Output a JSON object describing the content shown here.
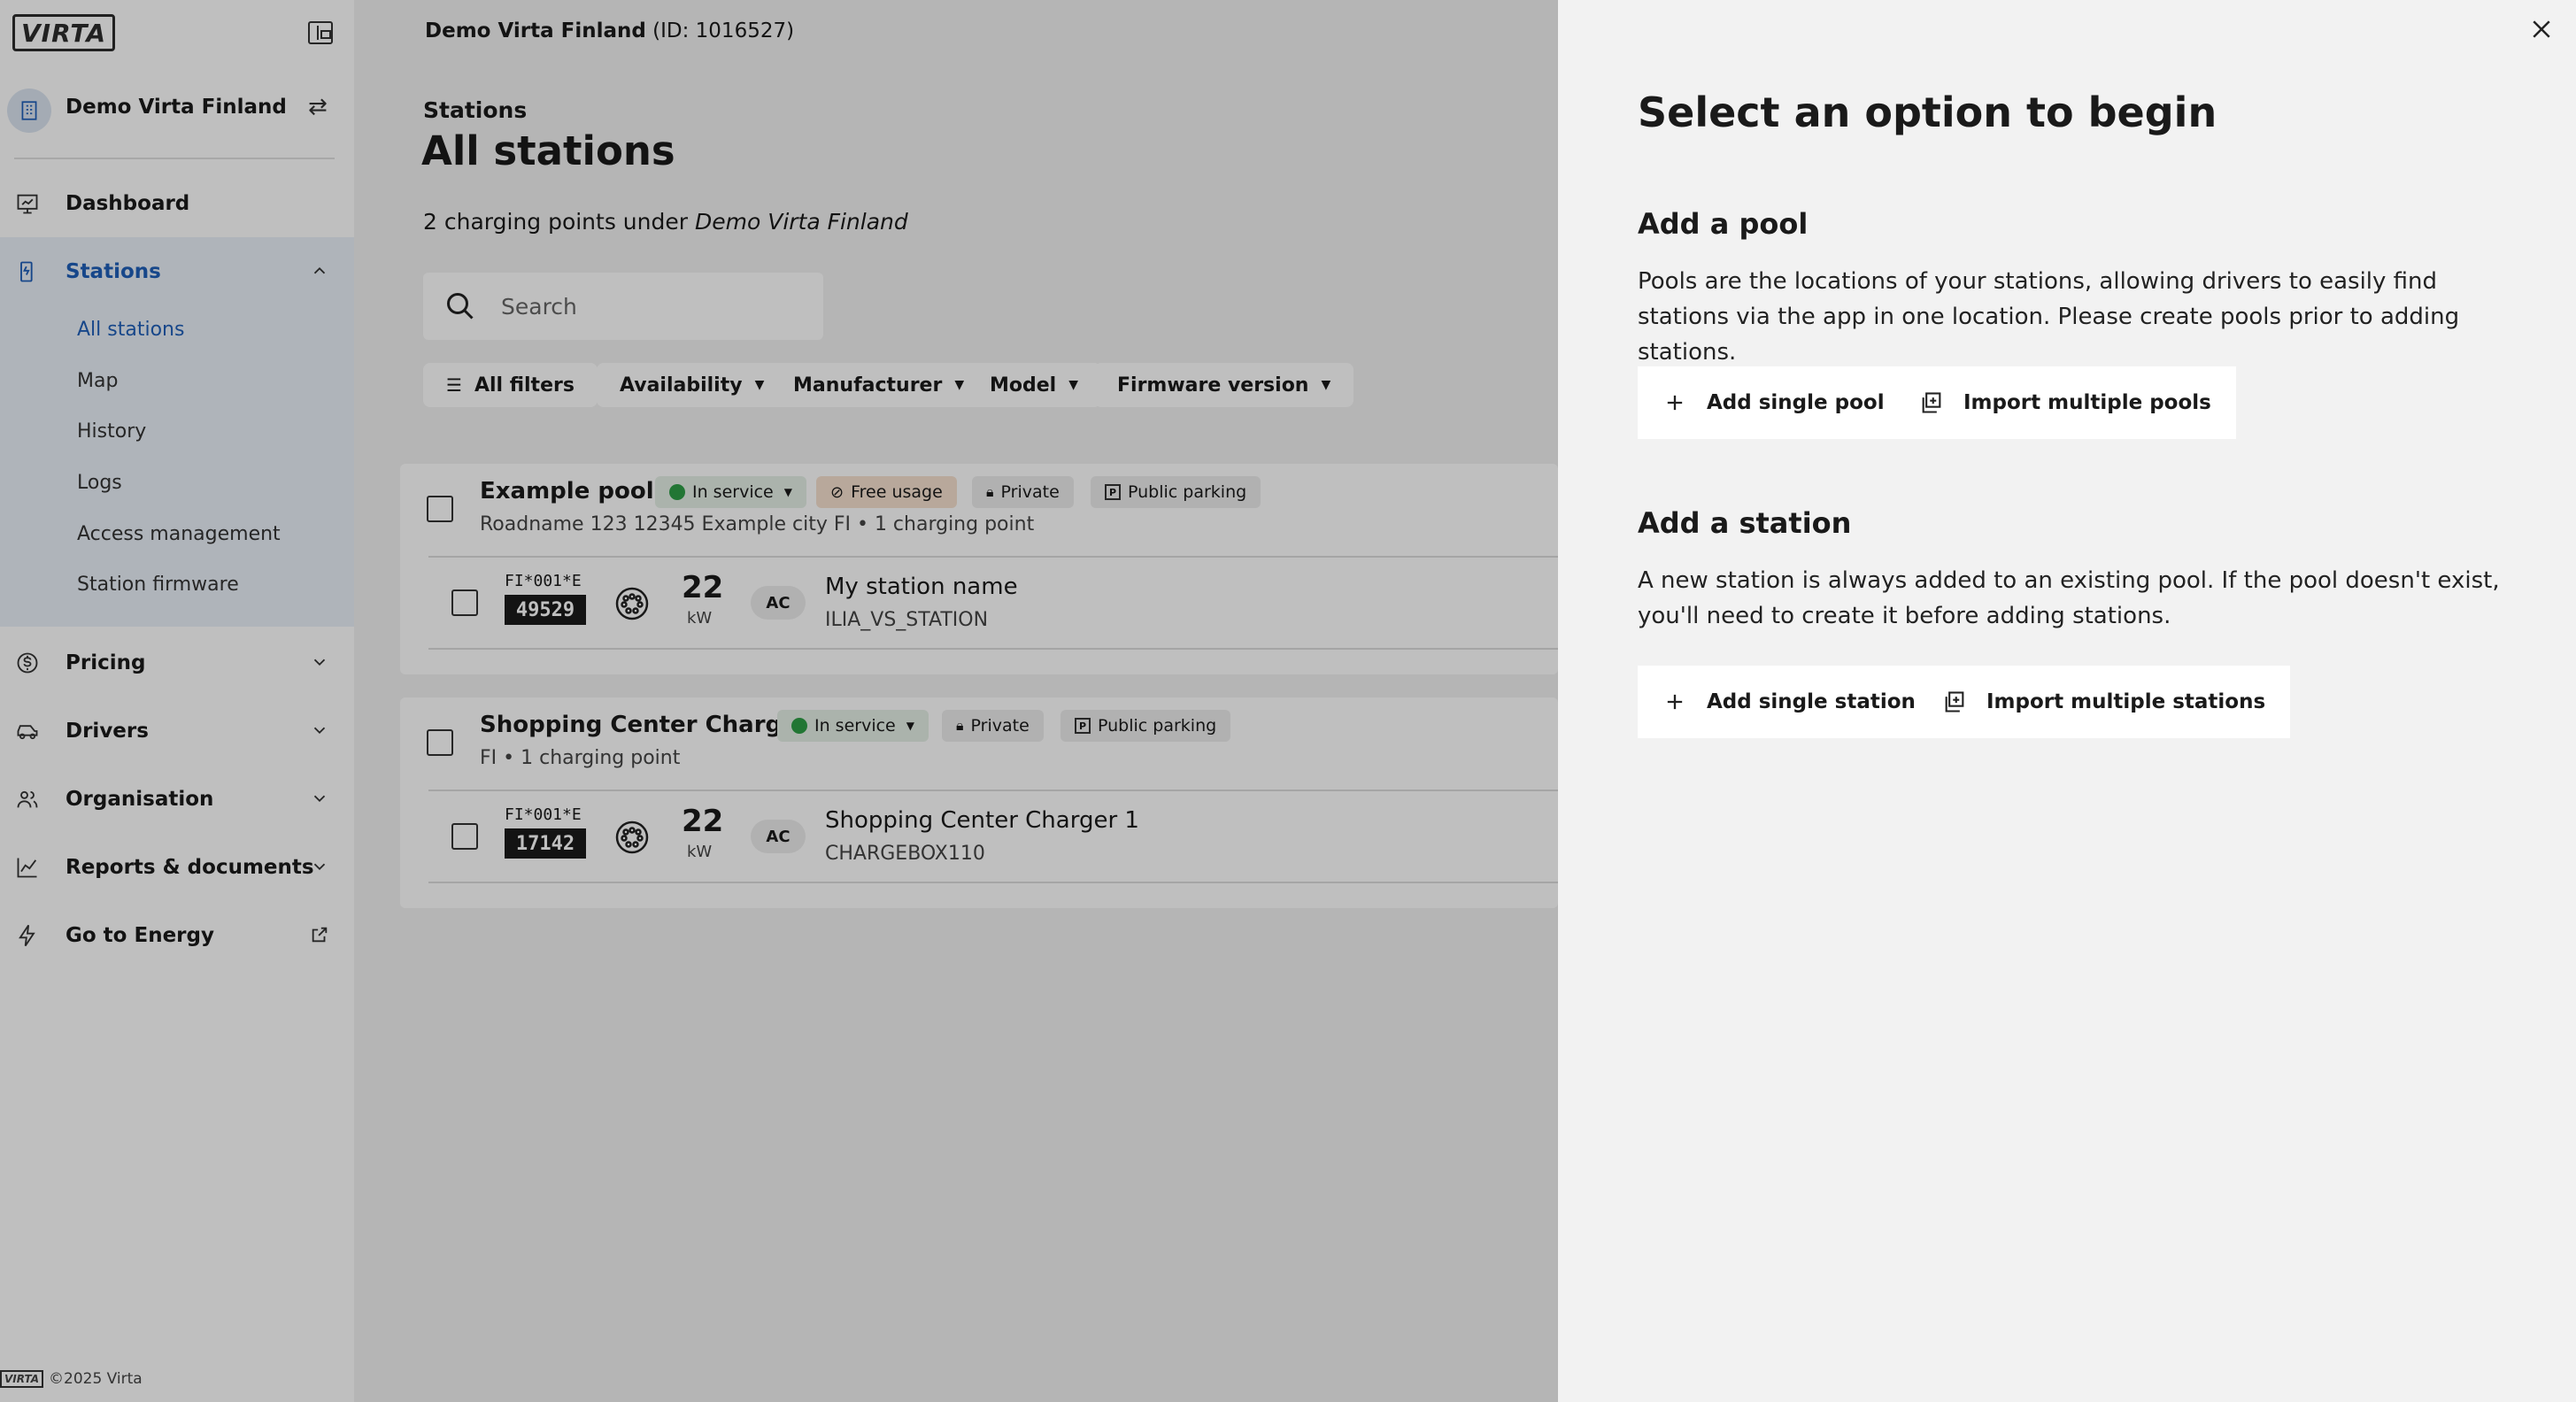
{
  "sidebar": {
    "logo_text": "VIRTA",
    "org_name": "Demo Virta Finland",
    "nav": {
      "dashboard": "Dashboard",
      "stations": "Stations",
      "pricing": "Pricing",
      "drivers": "Drivers",
      "organisation": "Organisation",
      "reports": "Reports & documents",
      "energy": "Go to Energy"
    },
    "stations_sub": [
      "All stations",
      "Map",
      "History",
      "Logs",
      "Access management",
      "Station firmware"
    ],
    "footer": "©2025 Virta",
    "footer_logo": "VIRTA"
  },
  "main": {
    "topbar_org": "Demo Virta Finland",
    "topbar_id": "(ID: 1016527)",
    "breadcrumb": "Stations",
    "title": "All stations",
    "count_prefix": "2 charging points under",
    "count_org": "Demo Virta Finland",
    "search_placeholder": "Search",
    "filters": [
      "All filters",
      "Availability",
      "Manufacturer",
      "Model",
      "Firmware version"
    ]
  },
  "pools": [
    {
      "name": "Example pool 1",
      "status": "In service",
      "free_usage": "Free usage",
      "private": "Private",
      "parking": "Public parking",
      "address": "Roadname 123 12345 Example city FI • 1 charging point",
      "station": {
        "evse_prefix": "FI*001*E",
        "evse_number": "49529",
        "power": "22",
        "unit": "kW",
        "current": "AC",
        "name": "My station name",
        "id": "ILIA_VS_STATION"
      }
    },
    {
      "name": "Shopping Center Charger 1",
      "status": "In service",
      "private": "Private",
      "parking": "Public parking",
      "address": "FI • 1 charging point",
      "station": {
        "evse_prefix": "FI*001*E",
        "evse_number": "17142",
        "power": "22",
        "unit": "kW",
        "current": "AC",
        "name": "Shopping Center Charger 1",
        "id": "CHARGEBOX110"
      }
    }
  ],
  "panel": {
    "title": "Select an option to begin",
    "pool_title": "Add a pool",
    "pool_text": "Pools are the locations of your stations, allowing drivers to easily find stations via the app in one location. Please create pools prior to adding stations.",
    "add_pool": "Add single pool",
    "import_pools": "Import multiple pools",
    "station_title": "Add a station",
    "station_text": "A new station is always added to an existing pool. If the pool doesn't exist, you'll need to create it before adding stations.",
    "add_station": "Add single station",
    "import_stations": "Import multiple stations"
  },
  "colors": {
    "accent": "#1f5fb8",
    "status_green": "#2e9e46",
    "highlight_bg": "#eaf0f8"
  }
}
